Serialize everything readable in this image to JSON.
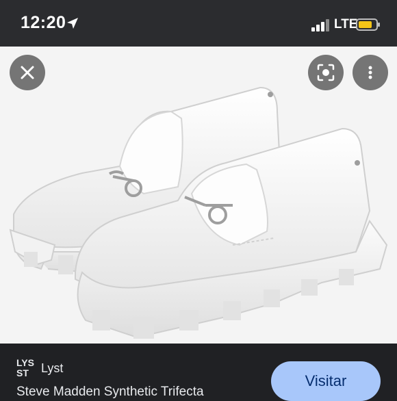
{
  "status_bar": {
    "time": "12:20",
    "network": "LTE",
    "location_icon": "location-arrow-icon",
    "signal_icon": "signal-bars-icon",
    "battery_icon": "battery-icon",
    "battery_color": "#f5c518"
  },
  "viewer": {
    "close_icon": "close-icon",
    "lens_icon": "lens-search-icon",
    "more_icon": "more-vert-icon",
    "image_subject": "white-patent-chunky-loafers"
  },
  "result": {
    "source_logo_text": "LYST",
    "source_name": "Lyst",
    "visit_label": "Visitar",
    "title": "Steve Madden Synthetic Trifecta",
    "button_color": "#a8c7fa"
  }
}
